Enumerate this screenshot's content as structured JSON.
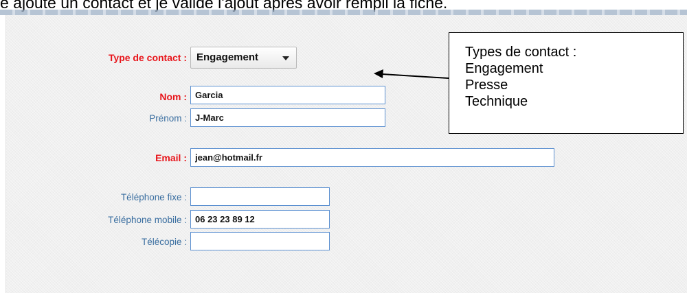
{
  "caption": "e ajoute un contact et je valide l'ajout après avoir rempli la fiche.",
  "form": {
    "contact_type": {
      "label": "Type de contact :",
      "value": "Engagement"
    },
    "nom": {
      "label": "Nom :",
      "value": "Garcia"
    },
    "prenom": {
      "label": "Prénom :",
      "value": "J-Marc"
    },
    "email": {
      "label": "Email :",
      "value": "jean@hotmail.fr"
    },
    "telephone_fixe": {
      "label": "Téléphone fixe :",
      "value": ""
    },
    "telephone_mobile": {
      "label": "Téléphone mobile :",
      "value": "06 23 23 89 12"
    },
    "telecopie": {
      "label": "Télécopie :",
      "value": ""
    }
  },
  "callout": {
    "title": "Types de contact :",
    "items": [
      "Engagement",
      "Presse",
      "Technique"
    ]
  },
  "colors": {
    "required_label": "#e8151b",
    "optional_label": "#3a6ea0",
    "field_border": "#5a8fd0"
  }
}
